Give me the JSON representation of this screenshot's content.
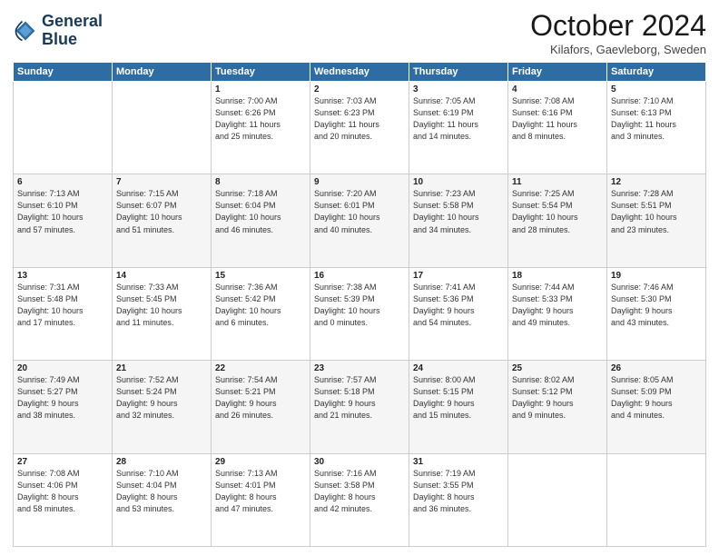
{
  "logo": {
    "line1": "General",
    "line2": "Blue"
  },
  "title": "October 2024",
  "subtitle": "Kilafors, Gaevleborg, Sweden",
  "days_header": [
    "Sunday",
    "Monday",
    "Tuesday",
    "Wednesday",
    "Thursday",
    "Friday",
    "Saturday"
  ],
  "weeks": [
    [
      {
        "num": "",
        "info": ""
      },
      {
        "num": "",
        "info": ""
      },
      {
        "num": "1",
        "info": "Sunrise: 7:00 AM\nSunset: 6:26 PM\nDaylight: 11 hours\nand 25 minutes."
      },
      {
        "num": "2",
        "info": "Sunrise: 7:03 AM\nSunset: 6:23 PM\nDaylight: 11 hours\nand 20 minutes."
      },
      {
        "num": "3",
        "info": "Sunrise: 7:05 AM\nSunset: 6:19 PM\nDaylight: 11 hours\nand 14 minutes."
      },
      {
        "num": "4",
        "info": "Sunrise: 7:08 AM\nSunset: 6:16 PM\nDaylight: 11 hours\nand 8 minutes."
      },
      {
        "num": "5",
        "info": "Sunrise: 7:10 AM\nSunset: 6:13 PM\nDaylight: 11 hours\nand 3 minutes."
      }
    ],
    [
      {
        "num": "6",
        "info": "Sunrise: 7:13 AM\nSunset: 6:10 PM\nDaylight: 10 hours\nand 57 minutes."
      },
      {
        "num": "7",
        "info": "Sunrise: 7:15 AM\nSunset: 6:07 PM\nDaylight: 10 hours\nand 51 minutes."
      },
      {
        "num": "8",
        "info": "Sunrise: 7:18 AM\nSunset: 6:04 PM\nDaylight: 10 hours\nand 46 minutes."
      },
      {
        "num": "9",
        "info": "Sunrise: 7:20 AM\nSunset: 6:01 PM\nDaylight: 10 hours\nand 40 minutes."
      },
      {
        "num": "10",
        "info": "Sunrise: 7:23 AM\nSunset: 5:58 PM\nDaylight: 10 hours\nand 34 minutes."
      },
      {
        "num": "11",
        "info": "Sunrise: 7:25 AM\nSunset: 5:54 PM\nDaylight: 10 hours\nand 28 minutes."
      },
      {
        "num": "12",
        "info": "Sunrise: 7:28 AM\nSunset: 5:51 PM\nDaylight: 10 hours\nand 23 minutes."
      }
    ],
    [
      {
        "num": "13",
        "info": "Sunrise: 7:31 AM\nSunset: 5:48 PM\nDaylight: 10 hours\nand 17 minutes."
      },
      {
        "num": "14",
        "info": "Sunrise: 7:33 AM\nSunset: 5:45 PM\nDaylight: 10 hours\nand 11 minutes."
      },
      {
        "num": "15",
        "info": "Sunrise: 7:36 AM\nSunset: 5:42 PM\nDaylight: 10 hours\nand 6 minutes."
      },
      {
        "num": "16",
        "info": "Sunrise: 7:38 AM\nSunset: 5:39 PM\nDaylight: 10 hours\nand 0 minutes."
      },
      {
        "num": "17",
        "info": "Sunrise: 7:41 AM\nSunset: 5:36 PM\nDaylight: 9 hours\nand 54 minutes."
      },
      {
        "num": "18",
        "info": "Sunrise: 7:44 AM\nSunset: 5:33 PM\nDaylight: 9 hours\nand 49 minutes."
      },
      {
        "num": "19",
        "info": "Sunrise: 7:46 AM\nSunset: 5:30 PM\nDaylight: 9 hours\nand 43 minutes."
      }
    ],
    [
      {
        "num": "20",
        "info": "Sunrise: 7:49 AM\nSunset: 5:27 PM\nDaylight: 9 hours\nand 38 minutes."
      },
      {
        "num": "21",
        "info": "Sunrise: 7:52 AM\nSunset: 5:24 PM\nDaylight: 9 hours\nand 32 minutes."
      },
      {
        "num": "22",
        "info": "Sunrise: 7:54 AM\nSunset: 5:21 PM\nDaylight: 9 hours\nand 26 minutes."
      },
      {
        "num": "23",
        "info": "Sunrise: 7:57 AM\nSunset: 5:18 PM\nDaylight: 9 hours\nand 21 minutes."
      },
      {
        "num": "24",
        "info": "Sunrise: 8:00 AM\nSunset: 5:15 PM\nDaylight: 9 hours\nand 15 minutes."
      },
      {
        "num": "25",
        "info": "Sunrise: 8:02 AM\nSunset: 5:12 PM\nDaylight: 9 hours\nand 9 minutes."
      },
      {
        "num": "26",
        "info": "Sunrise: 8:05 AM\nSunset: 5:09 PM\nDaylight: 9 hours\nand 4 minutes."
      }
    ],
    [
      {
        "num": "27",
        "info": "Sunrise: 7:08 AM\nSunset: 4:06 PM\nDaylight: 8 hours\nand 58 minutes."
      },
      {
        "num": "28",
        "info": "Sunrise: 7:10 AM\nSunset: 4:04 PM\nDaylight: 8 hours\nand 53 minutes."
      },
      {
        "num": "29",
        "info": "Sunrise: 7:13 AM\nSunset: 4:01 PM\nDaylight: 8 hours\nand 47 minutes."
      },
      {
        "num": "30",
        "info": "Sunrise: 7:16 AM\nSunset: 3:58 PM\nDaylight: 8 hours\nand 42 minutes."
      },
      {
        "num": "31",
        "info": "Sunrise: 7:19 AM\nSunset: 3:55 PM\nDaylight: 8 hours\nand 36 minutes."
      },
      {
        "num": "",
        "info": ""
      },
      {
        "num": "",
        "info": ""
      }
    ]
  ]
}
